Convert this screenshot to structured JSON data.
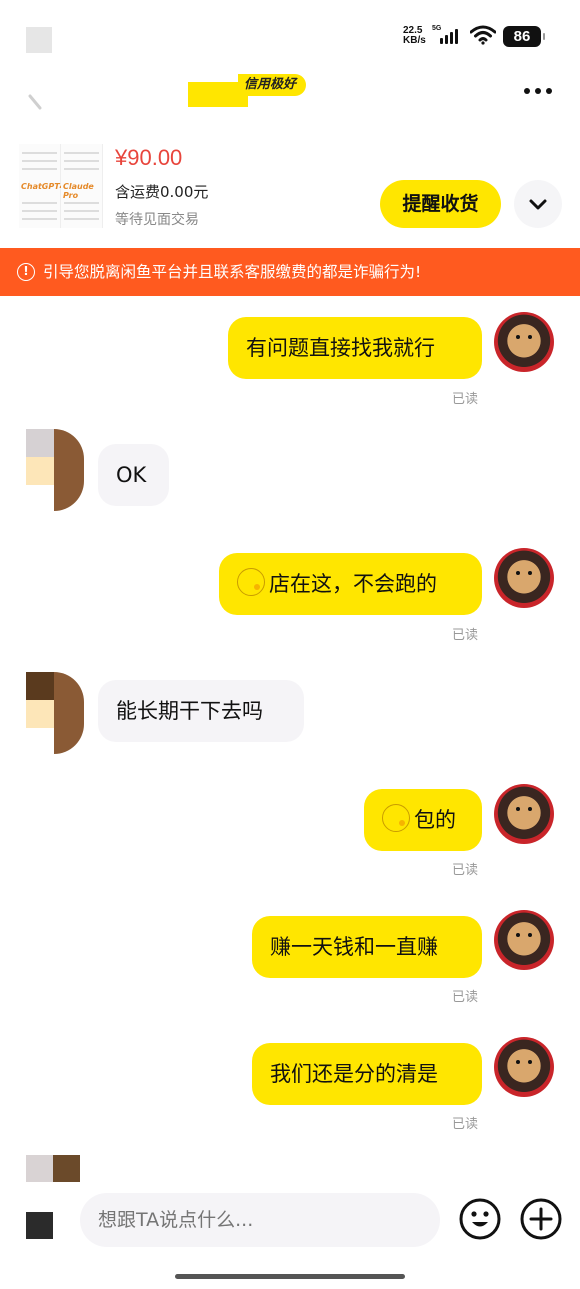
{
  "status_bar": {
    "speed_value": "22.5",
    "speed_unit": "KB/s",
    "network": "5G",
    "battery": "86"
  },
  "nav": {
    "credit_badge": "信用极好"
  },
  "product": {
    "price": "¥90.00",
    "shipping": "含运费0.00元",
    "trade_status": "等待见面交易",
    "remind_label": "提醒收货",
    "thumb_text_left": "ChatGPT4.0",
    "thumb_text_right": "Claude Pro"
  },
  "warning": {
    "text": "引导您脱离闲鱼平台并且联系客服缴费的都是诈骗行为!"
  },
  "messages": [
    {
      "from": "me",
      "text": "有问题直接找我就行",
      "status": "已读"
    },
    {
      "from": "other",
      "text": "OK"
    },
    {
      "from": "me",
      "text": "店在这，不会跑的",
      "status": "已读",
      "emoji": "smile-emoji"
    },
    {
      "from": "other",
      "text": "能长期干下去吗"
    },
    {
      "from": "me",
      "text": "包的",
      "status": "已读",
      "emoji": "smile-emoji"
    },
    {
      "from": "me",
      "text": "赚一天钱和一直赚",
      "status": "已读"
    },
    {
      "from": "me",
      "text": "我们还是分的清是",
      "status": "已读"
    }
  ],
  "input": {
    "placeholder": "想跟TA说点什么..."
  },
  "icons": {
    "back": "back-arrow-icon",
    "more": "more-dots-icon",
    "expand": "chevron-down-icon",
    "warning": "exclamation-circle-icon",
    "emoji": "smiley-icon",
    "plus": "plus-circle-icon"
  },
  "colors": {
    "accent_yellow": "#ffe600",
    "warning_orange": "#ff5a1f",
    "price_red": "#e8453c",
    "incoming_bubble": "#f5f4f7"
  }
}
